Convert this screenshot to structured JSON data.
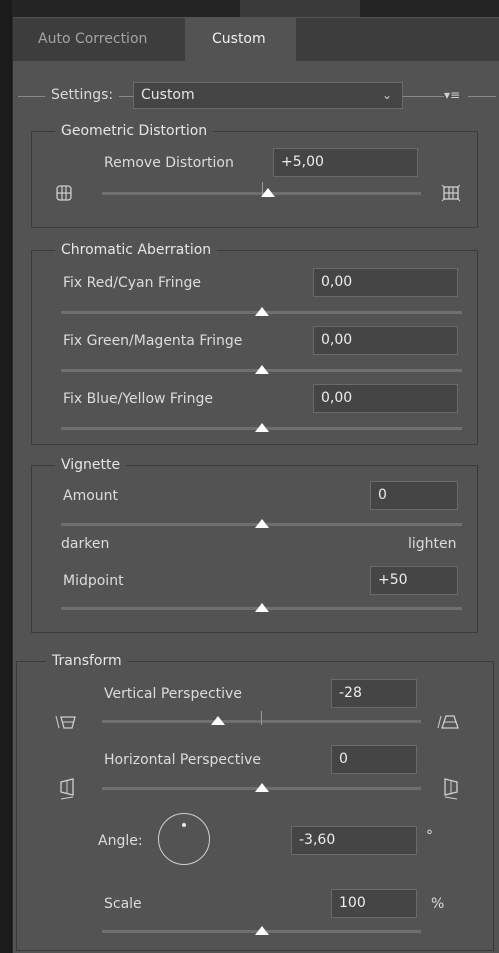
{
  "tabs": [
    {
      "label": "Auto Correction",
      "active": false
    },
    {
      "label": "Custom",
      "active": true
    }
  ],
  "settings": {
    "label": "Settings:",
    "value": "Custom",
    "chevron": "chevron-down-icon",
    "menu_icon": "flyout-menu-icon"
  },
  "geometric": {
    "title": "Geometric Distortion",
    "remove_label": "Remove Distortion",
    "remove_value": "+5,00",
    "slider_fraction": 0.5
  },
  "chromatic": {
    "title": "Chromatic Aberration",
    "rows": [
      {
        "label": "Fix Red/Cyan Fringe",
        "value": "0,00"
      },
      {
        "label": "Fix Green/Magenta Fringe",
        "value": "0,00"
      },
      {
        "label": "Fix Blue/Yellow Fringe",
        "value": "0,00"
      }
    ]
  },
  "vignette": {
    "title": "Vignette",
    "amount_label": "Amount",
    "amount_value": "0",
    "darken": "darken",
    "lighten": "lighten",
    "midpoint_label": "Midpoint",
    "midpoint_value": "+50"
  },
  "transform": {
    "title": "Transform",
    "vertical_label": "Vertical Perspective",
    "vertical_value": "-28",
    "horizontal_label": "Horizontal Perspective",
    "horizontal_value": "0",
    "angle_label": "Angle:",
    "angle_value": "-3,60",
    "angle_unit": "°",
    "scale_label": "Scale",
    "scale_value": "100",
    "scale_unit": "%"
  },
  "colors": {
    "panel": "#535353",
    "field": "#454545",
    "border": "#3b3b3b",
    "text": "#dcdcdc"
  }
}
